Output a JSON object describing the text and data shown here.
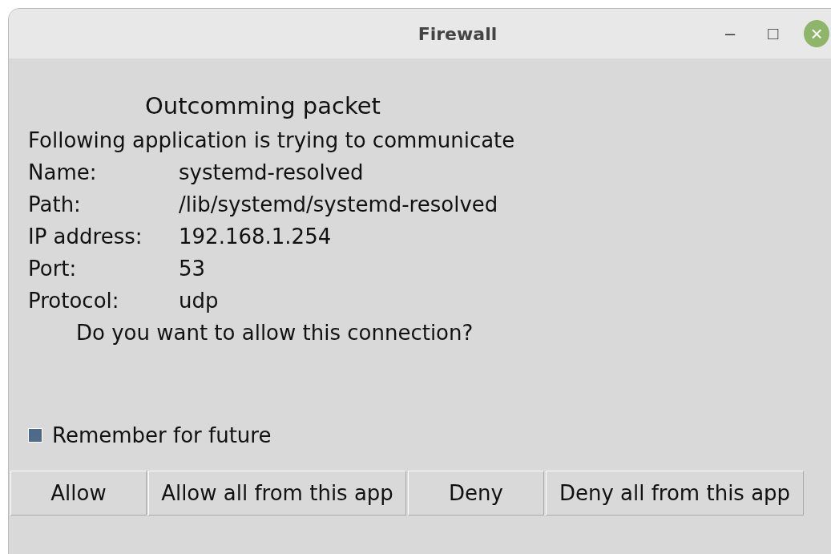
{
  "window": {
    "title": "Firewall",
    "controls": [
      "–",
      "□",
      "×"
    ]
  },
  "heading": "Outcomming packet",
  "intro": "Following application is trying to communicate",
  "fields": [
    {
      "label": "Name:",
      "value": "systemd-resolved"
    },
    {
      "label": "Path:",
      "value": "/lib/systemd/systemd-resolved"
    },
    {
      "label": "IP address:",
      "value": "192.168.1.254"
    },
    {
      "label": "Port:",
      "value": "53"
    },
    {
      "label": "Protocol:",
      "value": "udp"
    }
  ],
  "question": "Do you want to allow this connection?",
  "remember": {
    "label": "Remember for future",
    "checked": true
  },
  "buttons": [
    "Allow",
    "Allow all from this app",
    "Deny",
    "Deny all from this app"
  ]
}
